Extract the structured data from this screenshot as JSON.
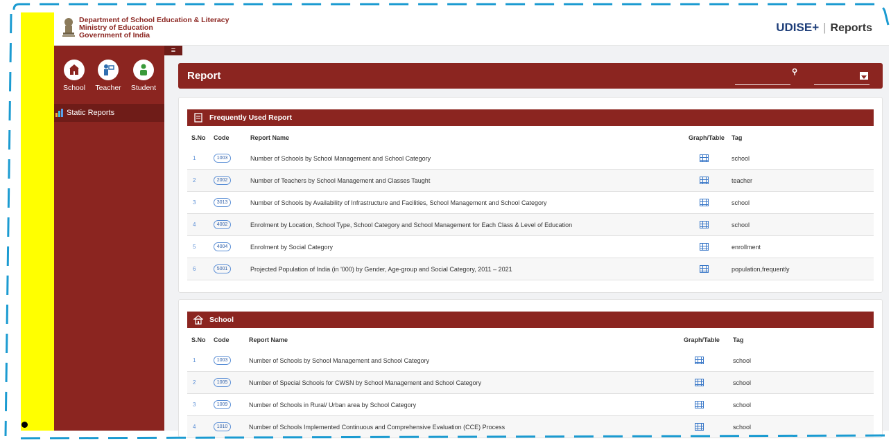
{
  "header": {
    "dept_line1": "Department of School Education & Literacy",
    "dept_line2": "Ministry of Education",
    "dept_line3": "Government of India",
    "brand": "UDISE+",
    "brand_sep": "|",
    "brand_section": "Reports"
  },
  "sidebar": {
    "menu_icon": "hamburger-icon",
    "categories": [
      {
        "label": "School",
        "icon": "school-icon"
      },
      {
        "label": "Teacher",
        "icon": "teacher-icon"
      },
      {
        "label": "Student",
        "icon": "student-icon"
      }
    ],
    "static_reports": "Static Reports"
  },
  "report_bar": {
    "title": "Report",
    "search_icon": "search-icon",
    "dropdown_icon": "chevron-down-icon"
  },
  "columns": {
    "sno": "S.No",
    "code": "Code",
    "name": "Report Name",
    "graph": "Graph/Table",
    "tag": "Tag"
  },
  "frequent": {
    "title": "Frequently Used Report",
    "rows": [
      {
        "sno": "1",
        "code": "1003",
        "name": "Number of Schools by School Management and School Category",
        "tag": "school"
      },
      {
        "sno": "2",
        "code": "2002",
        "name": "Number of Teachers by School Management and Classes Taught",
        "tag": "teacher"
      },
      {
        "sno": "3",
        "code": "3013",
        "name": "Number of Schools by Availability of Infrastructure and Facilities, School Management and School Category",
        "tag": "school"
      },
      {
        "sno": "4",
        "code": "4002",
        "name": "Enrolment by Location, School Type, School Category and School Management for Each Class & Level of Education",
        "tag": "school"
      },
      {
        "sno": "5",
        "code": "4004",
        "name": "Enrolment by Social Category",
        "tag": "enrollment"
      },
      {
        "sno": "6",
        "code": "5001",
        "name": "Projected Population of India (in '000) by Gender, Age-group and Social Category, 2011 – 2021",
        "tag": "population,frequently"
      }
    ]
  },
  "school": {
    "title": "School",
    "rows": [
      {
        "sno": "1",
        "code": "1003",
        "name": "Number of Schools by School Management and School Category",
        "tag": "school"
      },
      {
        "sno": "2",
        "code": "1005",
        "name": "Number of Special Schools for CWSN by School Management and School Category",
        "tag": "school"
      },
      {
        "sno": "3",
        "code": "1009",
        "name": "Number of Schools in Rural/ Urban area by School Category",
        "tag": "school"
      },
      {
        "sno": "4",
        "code": "1010",
        "name": "Number of Schools Implemented Continuous and Comprehensive Evaluation (CCE) Process",
        "tag": "school"
      }
    ]
  }
}
